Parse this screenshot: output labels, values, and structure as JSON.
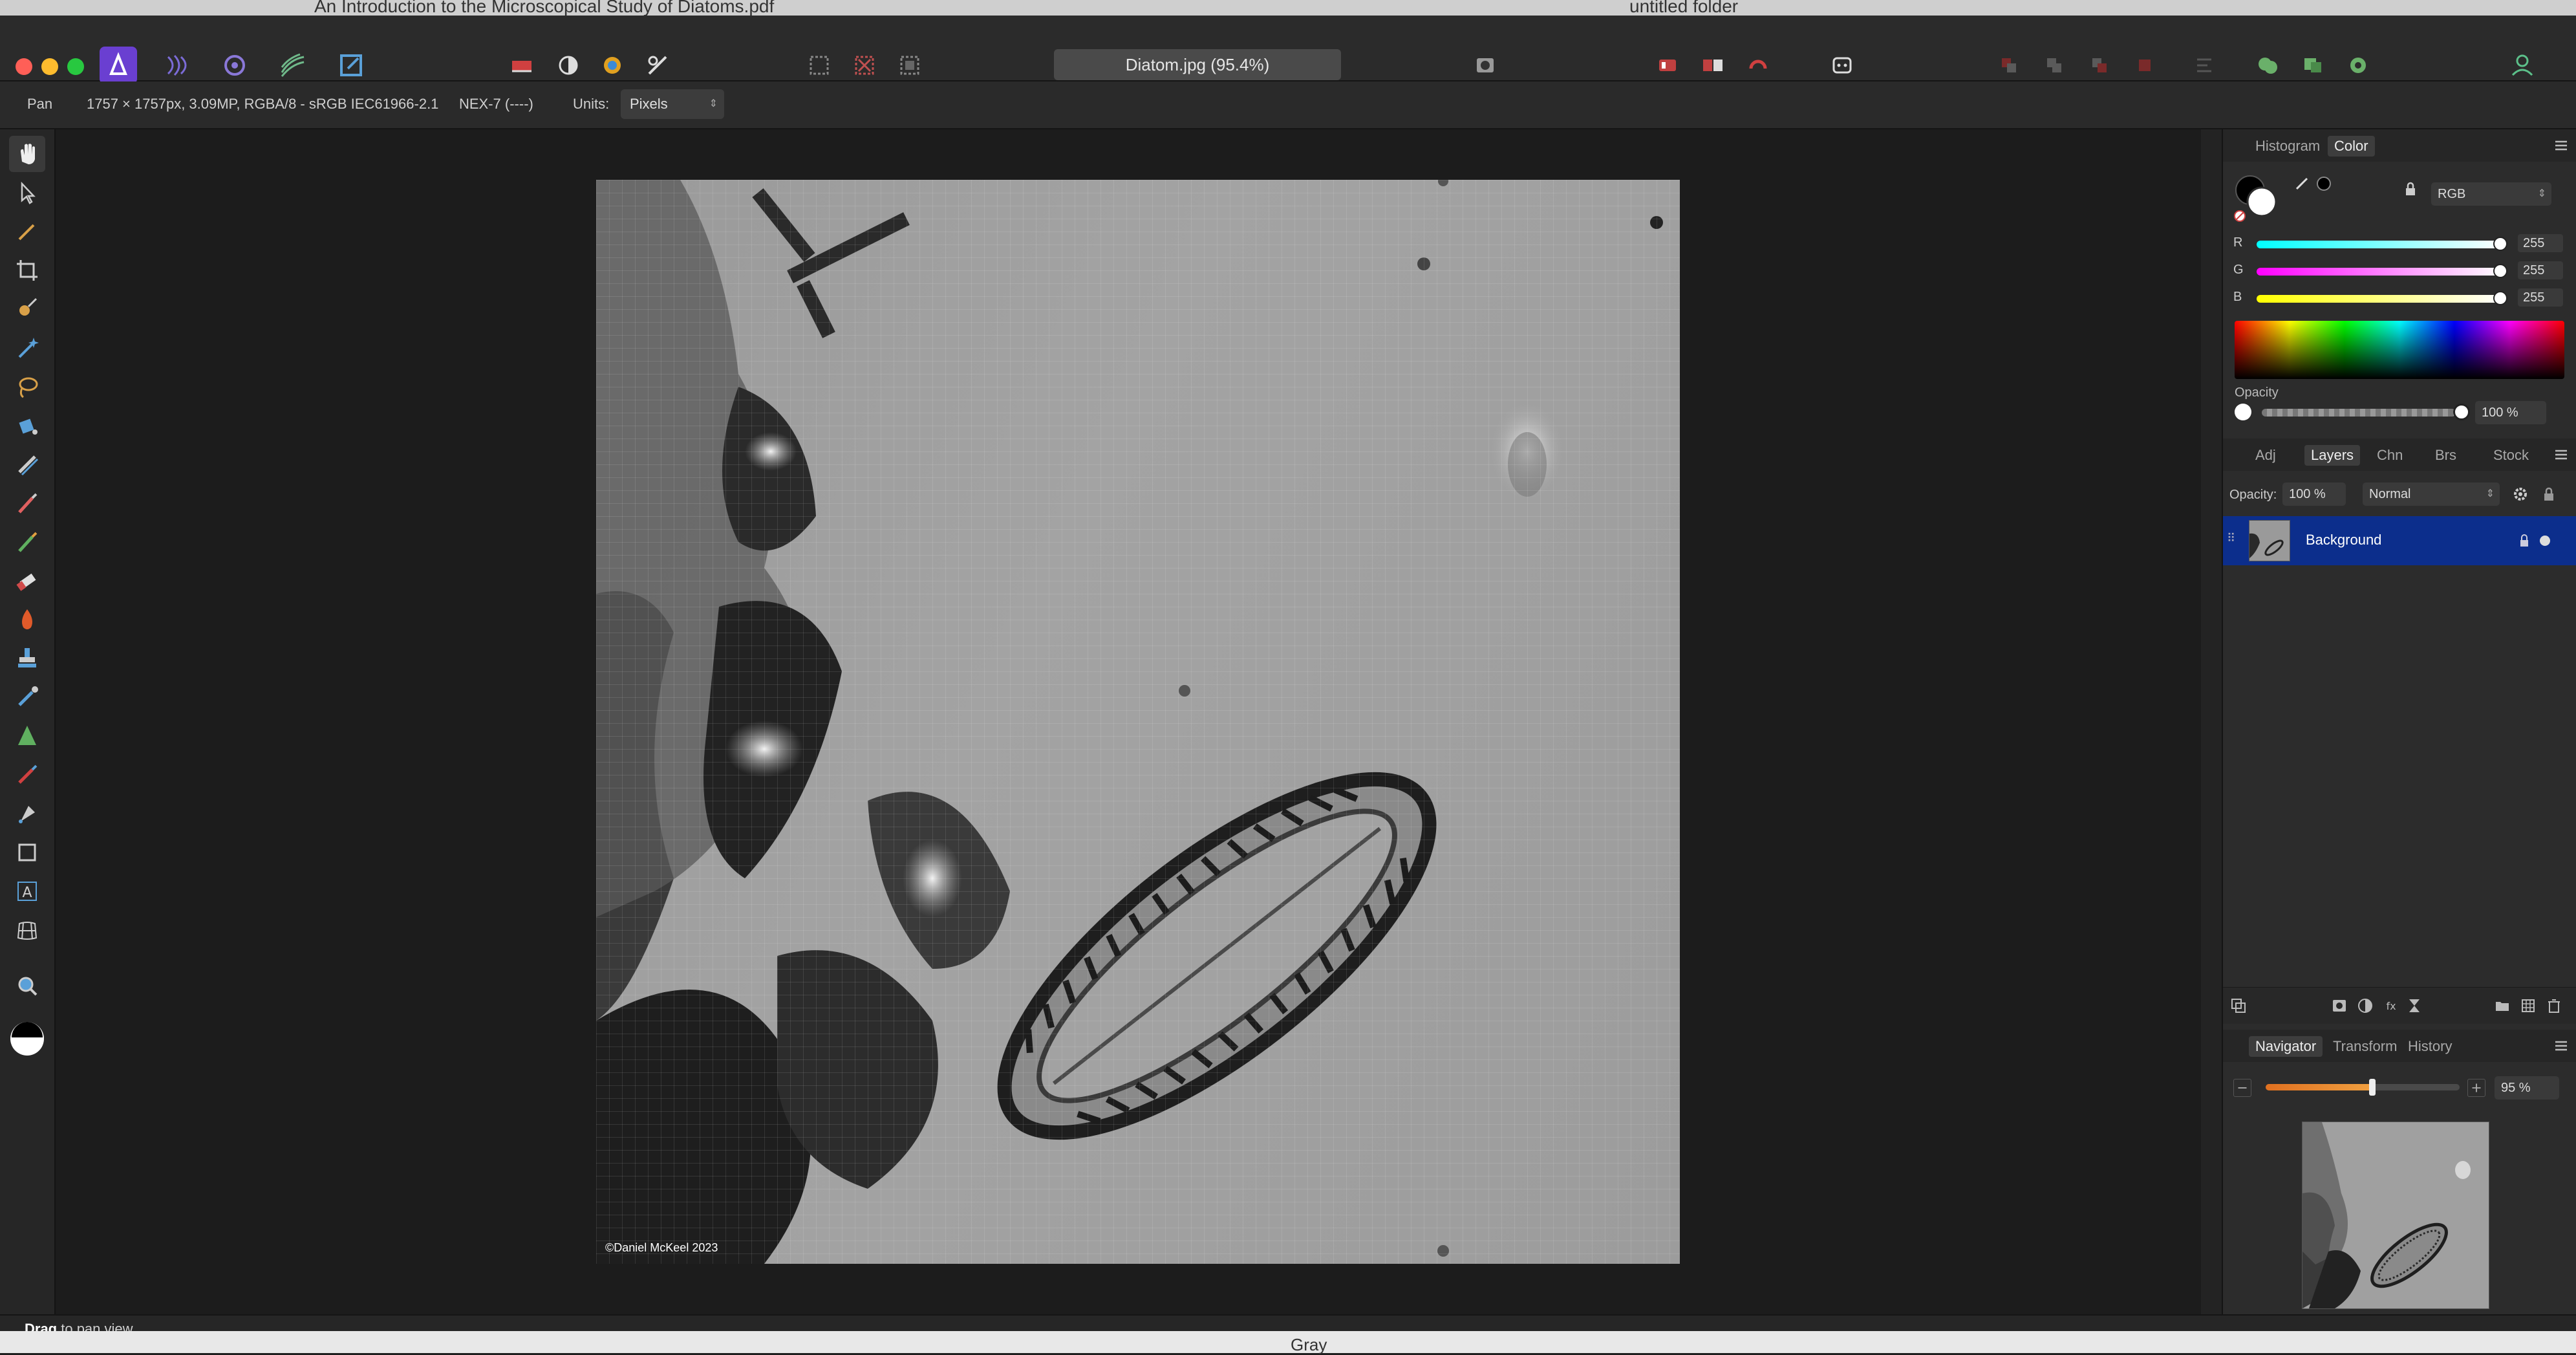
{
  "background_windows": {
    "pdf_title": "An Introduction to the Microscopical Study of Diatoms.pdf",
    "folder_title": "untitled folder",
    "bottom_text": "Gray"
  },
  "toolbar": {
    "document_title": "Diatom.jpg (95.4%)",
    "apps": [
      "photo-persona-icon",
      "liquify-persona-icon",
      "develop-persona-icon",
      "tone-mapping-persona-icon",
      "export-persona-icon"
    ]
  },
  "context_bar": {
    "tool_name": "Pan",
    "doc_info": "1757 × 1757px, 3.09MP, RGBA/8 - sRGB IEC61966-2.1",
    "camera": "NEX-7 (----)",
    "units_label": "Units:",
    "units_value": "Pixels"
  },
  "canvas": {
    "watermark": "©Daniel McKeel 2023"
  },
  "status": {
    "action": "Drag",
    "rest": " to pan view."
  },
  "color_panel": {
    "tabs": [
      "Histogram",
      "Color"
    ],
    "active_tab": "Color",
    "mode": "RGB",
    "r_label": "R",
    "r_value": "255",
    "g_label": "G",
    "g_value": "255",
    "b_label": "B",
    "b_value": "255",
    "opacity_label": "Opacity",
    "opacity_value": "100 %"
  },
  "layers_panel": {
    "tabs": [
      "Adj",
      "Layers",
      "Chn",
      "Brs",
      "Stock"
    ],
    "active_tab": "Layers",
    "opacity_label": "Opacity:",
    "opacity_value": "100 %",
    "blend_mode": "Normal",
    "layer_name": "Background"
  },
  "navigator_panel": {
    "tabs": [
      "Navigator",
      "Transform",
      "History"
    ],
    "active_tab": "Navigator",
    "zoom_value": "95 %",
    "zoom_fraction": 0.55
  },
  "colors": {
    "accent": "#0c2e8c",
    "photo_icon": "#6a3fd1"
  }
}
